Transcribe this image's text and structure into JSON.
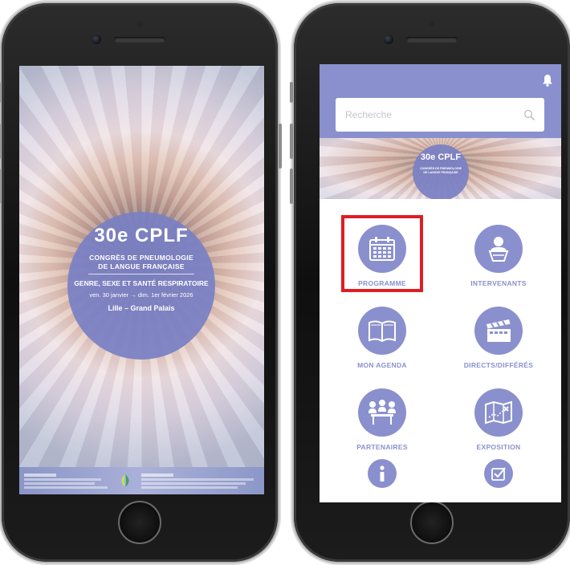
{
  "splash": {
    "title": "30e CPLF",
    "subtitle_line1": "CONGRÈS DE PNEUMOLOGIE",
    "subtitle_line2": "DE LANGUE FRANÇAISE",
    "theme": "GENRE, SEXE ET SANTÉ RESPIRATOIRE",
    "dates": "ven. 30 janvier → dim. 1er février 2026",
    "place": "Lille – Grand Palais"
  },
  "app": {
    "search": {
      "placeholder": "Recherche"
    },
    "banner": {
      "title": "30e CPLF",
      "subtitle_line1": "CONGRÈS DE PNEUMOLOGIE",
      "subtitle_line2": "DE LANGUE FRANÇAISE"
    },
    "menu": [
      {
        "label": "PROGRAMME",
        "icon": "calendar-icon"
      },
      {
        "label": "INTERVENANTS",
        "icon": "speaker-icon"
      },
      {
        "label": "MON AGENDA",
        "icon": "book-icon"
      },
      {
        "label": "DIRECTS/DIFFÉRÉS",
        "icon": "clapperboard-icon"
      },
      {
        "label": "PARTENAIRES",
        "icon": "partners-icon"
      },
      {
        "label": "EXPOSITION",
        "icon": "map-icon"
      }
    ],
    "colors": {
      "accent": "#8a90cd",
      "highlight": "#e01c24"
    }
  }
}
